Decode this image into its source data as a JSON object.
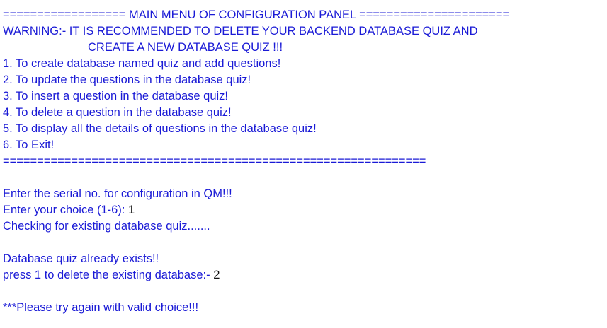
{
  "console": {
    "header": "================== MAIN MENU OF CONFIGURATION PANEL ======================",
    "warning_line1": "WARNING:- IT IS RECOMMENDED TO DELETE YOUR BACKEND DATABASE QUIZ AND",
    "warning_line2": "CREATE A NEW DATABASE QUIZ !!!",
    "menu_items": [
      "1. To create database named quiz and add questions!",
      "2. To update the questions in the database quiz!",
      "3. To insert a question in the database quiz!",
      "4. To delete a question in the database quiz!",
      "5. To display all the details of questions in the database quiz!",
      "6. To Exit!"
    ],
    "separator": "==============================================================",
    "serial_prompt": "Enter the serial no. for configuration in QM!!!",
    "choice_prompt": "Enter your choice (1-6): ",
    "choice_value": "1",
    "checking_msg": "Checking for existing database quiz.......",
    "exists_msg": "Database quiz already exists!!",
    "delete_prompt": "press 1 to delete the existing database:- ",
    "delete_value": "2",
    "error_msg": "***Please try again with valid choice!!!"
  },
  "colors": {
    "text": "#1a1ad6",
    "input": "#111111",
    "background": "#ffffff"
  }
}
